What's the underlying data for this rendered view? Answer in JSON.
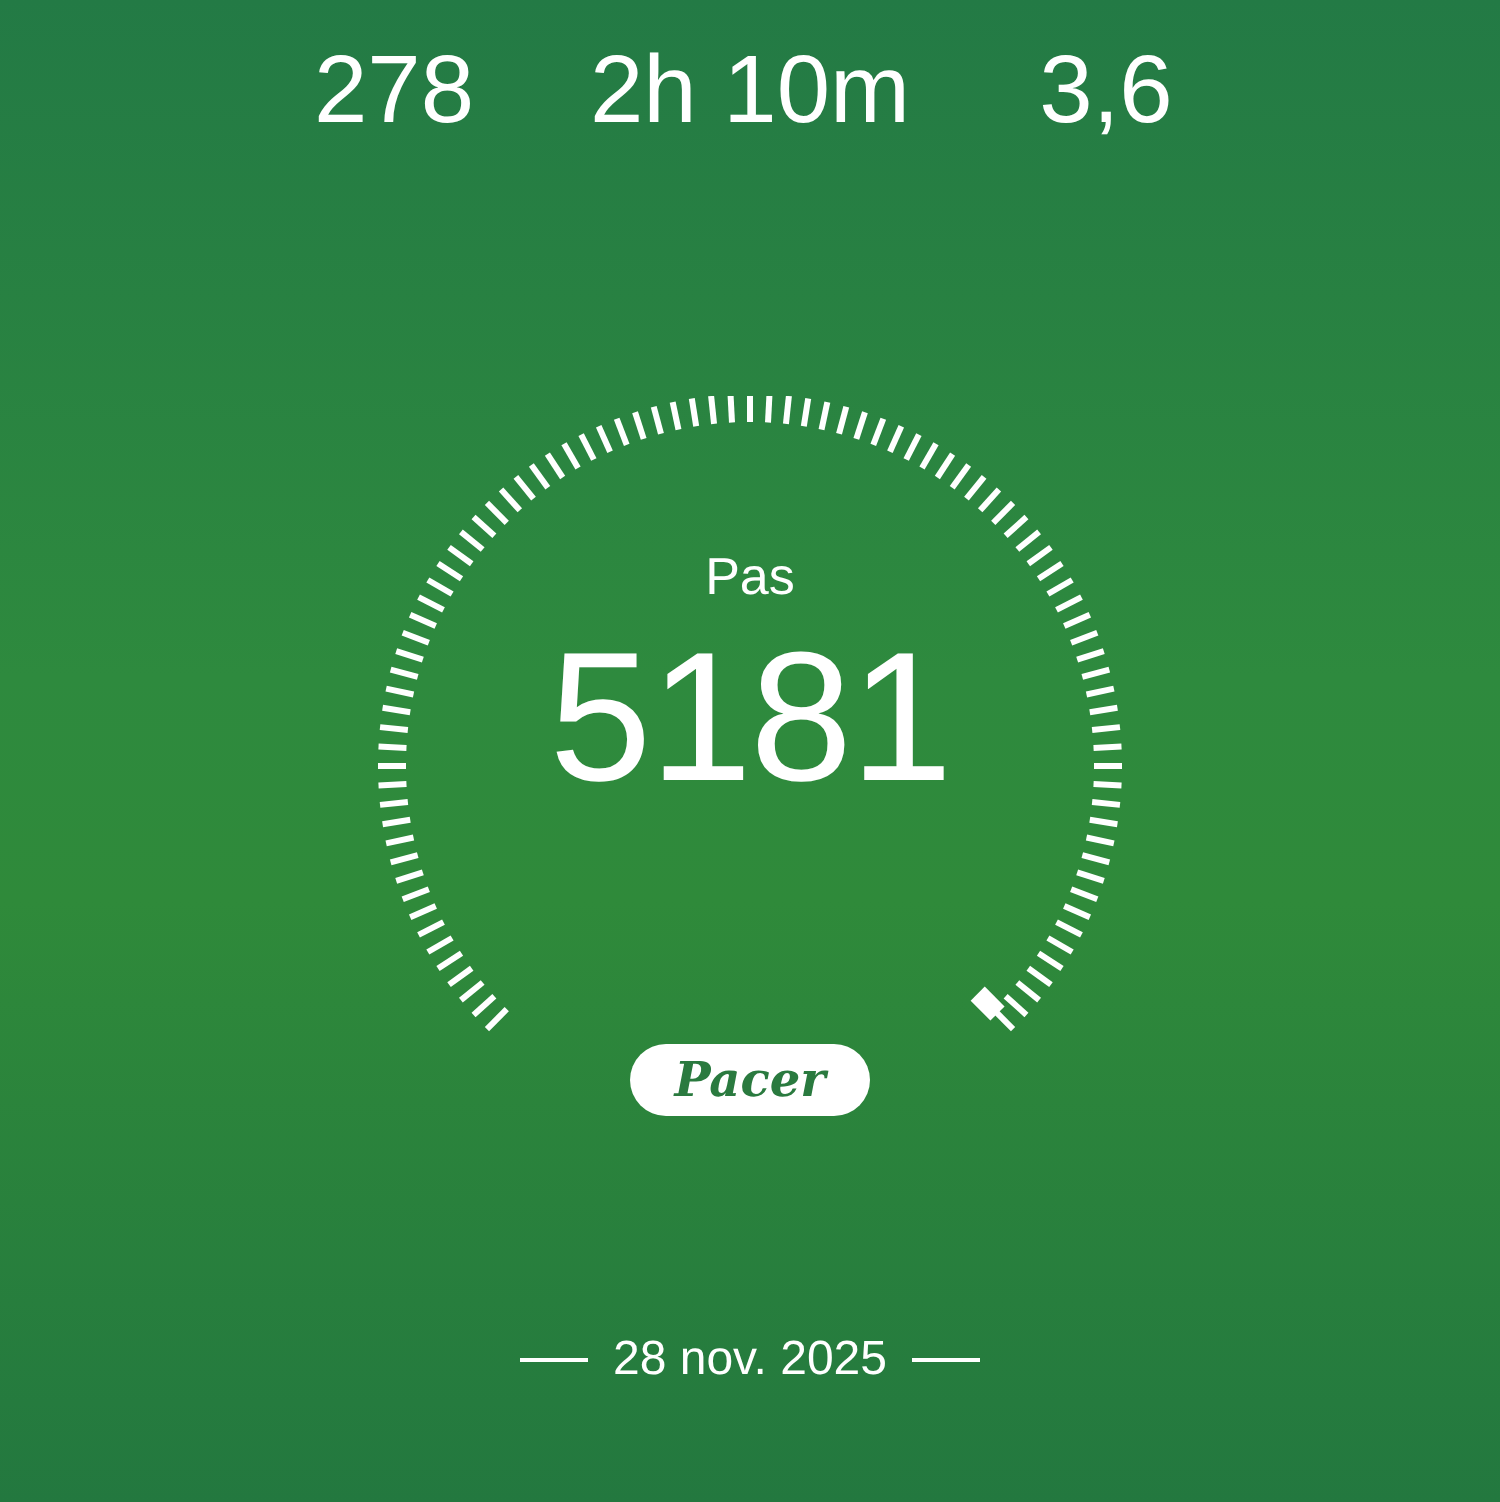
{
  "stats": [
    {
      "value": "278"
    },
    {
      "value": "2h 10m"
    },
    {
      "value": "3,6"
    }
  ],
  "gauge": {
    "label": "Pas",
    "value": "5181"
  },
  "brand": "Pacer",
  "date": "28 nov. 2025"
}
